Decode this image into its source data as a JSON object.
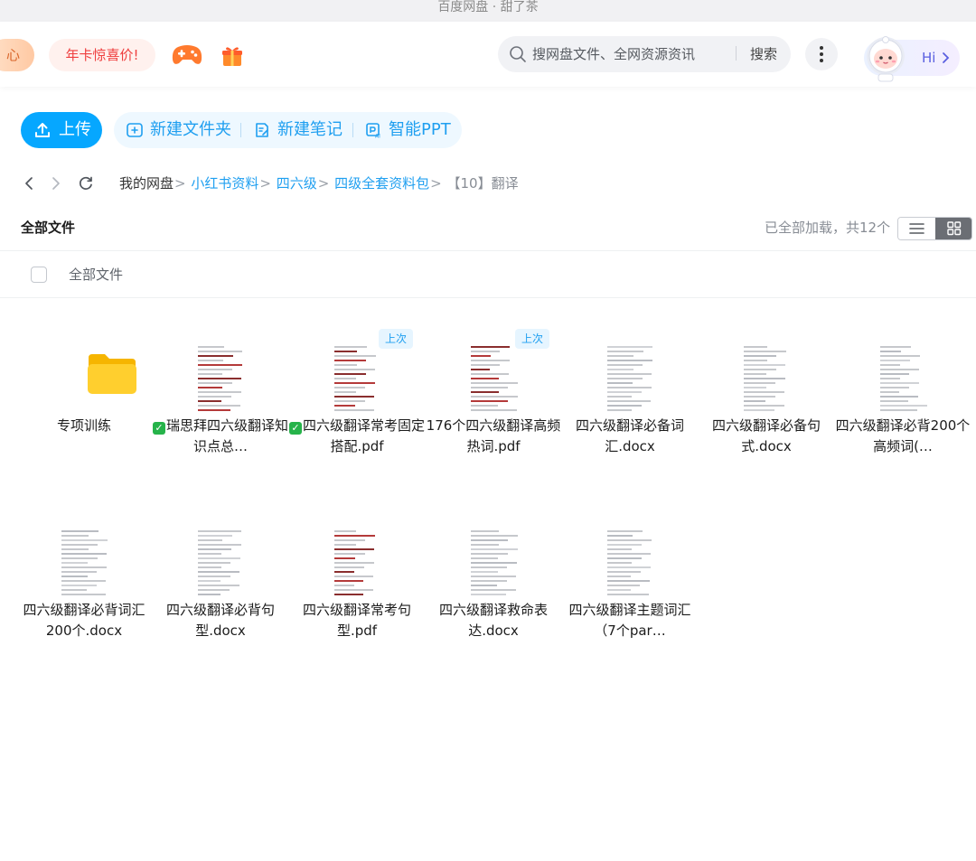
{
  "window": {
    "title": "百度网盘 · 甜了茶"
  },
  "header": {
    "promo_center": "心",
    "promo_year_card": "年卡惊喜价!",
    "game_icon": "gamepad-icon",
    "gift_icon": "gift-icon",
    "search": {
      "placeholder": "搜网盘文件、全网资源资讯",
      "button": "搜索"
    },
    "more_icon": "more-vertical-icon",
    "assistant": {
      "greeting": "Hi",
      "avatar": "astronaut-avatar"
    }
  },
  "toolbar": {
    "upload": "上传",
    "new_folder": "新建文件夹",
    "new_note": "新建笔记",
    "smart_ppt": "智能PPT"
  },
  "breadcrumb": {
    "root": "我的网盘",
    "items": [
      "小红书资料",
      "四六级",
      "四级全套资料包"
    ],
    "current": "【10】翻译",
    "separator": ">"
  },
  "list": {
    "title": "全部文件",
    "status": "已全部加载，共12个",
    "select_all_label": "全部文件",
    "view_mode": "grid",
    "accent": "#06a7ff"
  },
  "files": [
    {
      "kind": "folder",
      "name": "专项训练"
    },
    {
      "kind": "pdf",
      "checked": true,
      "name": "瑞思拜四六级翻译知识点总…"
    },
    {
      "kind": "pdf",
      "checked": true,
      "tag": "上次",
      "name": "四六级翻译常考固定搭配.pdf"
    },
    {
      "kind": "pdf",
      "tag": "上次",
      "name": "176个四六级翻译高频热词.pdf"
    },
    {
      "kind": "docx",
      "name": "四六级翻译必备词汇.docx"
    },
    {
      "kind": "docx",
      "name": "四六级翻译必备句式.docx"
    },
    {
      "kind": "docx",
      "name": "四六级翻译必背200个高频词(…"
    },
    {
      "kind": "docx",
      "name": "四六级翻译必背词汇200个.docx"
    },
    {
      "kind": "docx",
      "name": "四六级翻译必背句型.docx"
    },
    {
      "kind": "pdf",
      "name": "四六级翻译常考句型.pdf"
    },
    {
      "kind": "docx",
      "name": "四六级翻译救命表达.docx"
    },
    {
      "kind": "docx",
      "name": "四六级翻译主题词汇（7个par…"
    }
  ]
}
